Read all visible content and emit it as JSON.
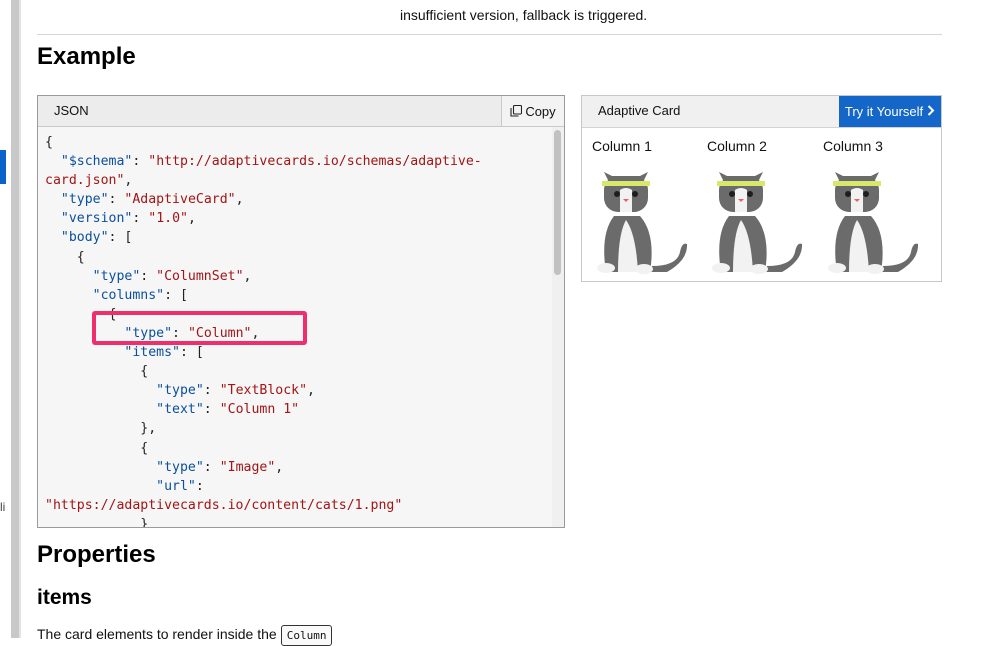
{
  "top_text": "insufficient version, fallback is triggered.",
  "left_fragment": "li",
  "headings": {
    "example": "Example",
    "properties": "Properties",
    "items": "items"
  },
  "json_panel": {
    "title": "JSON",
    "copy_label": "Copy",
    "code_lines": [
      [
        [
          "p",
          "{"
        ]
      ],
      [
        [
          "p",
          "  "
        ],
        [
          "k",
          "\"$schema\""
        ],
        [
          "p",
          ": "
        ],
        [
          "s",
          "\"http://adaptivecards.io/schemas/adaptive-"
        ]
      ],
      [
        [
          "s",
          "card.json\""
        ],
        [
          "p",
          ","
        ]
      ],
      [
        [
          "p",
          "  "
        ],
        [
          "k",
          "\"type\""
        ],
        [
          "p",
          ": "
        ],
        [
          "s",
          "\"AdaptiveCard\""
        ],
        [
          "p",
          ","
        ]
      ],
      [
        [
          "p",
          "  "
        ],
        [
          "k",
          "\"version\""
        ],
        [
          "p",
          ": "
        ],
        [
          "s",
          "\"1.0\""
        ],
        [
          "p",
          ","
        ]
      ],
      [
        [
          "p",
          "  "
        ],
        [
          "k",
          "\"body\""
        ],
        [
          "p",
          ": ["
        ]
      ],
      [
        [
          "p",
          "    {"
        ]
      ],
      [
        [
          "p",
          "      "
        ],
        [
          "k",
          "\"type\""
        ],
        [
          "p",
          ": "
        ],
        [
          "s",
          "\"ColumnSet\""
        ],
        [
          "p",
          ","
        ]
      ],
      [
        [
          "p",
          "      "
        ],
        [
          "k",
          "\"columns\""
        ],
        [
          "p",
          ": ["
        ]
      ],
      [
        [
          "p",
          "        {"
        ]
      ],
      [
        [
          "p",
          "          "
        ],
        [
          "k",
          "\"type\""
        ],
        [
          "p",
          ": "
        ],
        [
          "s",
          "\"Column\""
        ],
        [
          "p",
          ","
        ]
      ],
      [
        [
          "p",
          "          "
        ],
        [
          "k",
          "\"items\""
        ],
        [
          "p",
          ": ["
        ]
      ],
      [
        [
          "p",
          "            {"
        ]
      ],
      [
        [
          "p",
          "              "
        ],
        [
          "k",
          "\"type\""
        ],
        [
          "p",
          ": "
        ],
        [
          "s",
          "\"TextBlock\""
        ],
        [
          "p",
          ","
        ]
      ],
      [
        [
          "p",
          "              "
        ],
        [
          "k",
          "\"text\""
        ],
        [
          "p",
          ": "
        ],
        [
          "s",
          "\"Column 1\""
        ]
      ],
      [
        [
          "p",
          "            },"
        ]
      ],
      [
        [
          "p",
          "            {"
        ]
      ],
      [
        [
          "p",
          "              "
        ],
        [
          "k",
          "\"type\""
        ],
        [
          "p",
          ": "
        ],
        [
          "s",
          "\"Image\""
        ],
        [
          "p",
          ","
        ]
      ],
      [
        [
          "p",
          "              "
        ],
        [
          "k",
          "\"url\""
        ],
        [
          "p",
          ":"
        ]
      ],
      [
        [
          "s",
          "\"https://adaptivecards.io/content/cats/1.png\""
        ]
      ],
      [
        [
          "p",
          "            }"
        ]
      ]
    ]
  },
  "card_panel": {
    "title": "Adaptive Card",
    "try_label": "Try it Yourself",
    "columns": [
      {
        "label": "Column 1"
      },
      {
        "label": "Column 2"
      },
      {
        "label": "Column 3"
      }
    ]
  },
  "description": {
    "text": "The card elements to render inside the",
    "code": "Column"
  },
  "colors": {
    "link_button": "#1466c8",
    "highlight_border": "#ee2f6b",
    "json_key": "#0a4f9e",
    "json_string": "#a31515"
  }
}
